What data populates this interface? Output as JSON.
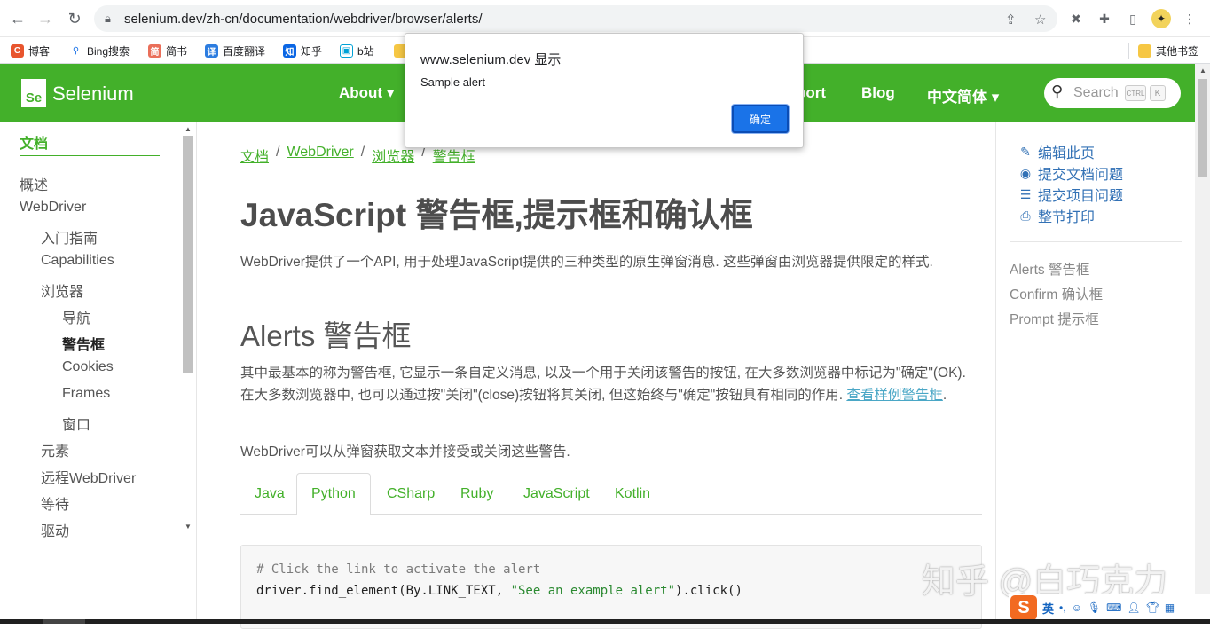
{
  "browser": {
    "url": "selenium.dev/zh-cn/documentation/webdriver/browser/alerts/",
    "bookmarks": [
      "博客",
      "Bing搜索",
      "简书",
      "百度翻译",
      "知乎",
      "b站"
    ],
    "other_bookmarks": "其他书签"
  },
  "site": {
    "brand": "Selenium",
    "nav": [
      "About ▾",
      "port",
      "Blog",
      "中文简体 ▾"
    ],
    "search_placeholder": "Search",
    "kbd_ctrl": "CTRL",
    "kbd_k": "K"
  },
  "sidebar": {
    "heading": "文档",
    "items": [
      "概述",
      "WebDriver",
      "入门指南",
      "Capabilities",
      "浏览器",
      "导航",
      "警告框",
      "Cookies",
      "Frames",
      "窗口",
      "元素",
      "远程WebDriver",
      "等待",
      "驱动"
    ]
  },
  "main": {
    "breadcrumbs": [
      "文档",
      "WebDriver",
      "浏览器",
      "警告框"
    ],
    "title": "JavaScript 警告框,提示框和确认框",
    "intro": "WebDriver提供了一个API, 用于处理JavaScript提供的三种类型的原生弹窗消息. 这些弹窗由浏览器提供限定的样式.",
    "section_title": "Alerts 警告框",
    "para1": "其中最基本的称为警告框, 它显示一条自定义消息, 以及一个用于关闭该警告的按钮, 在大多数浏览器中标记为\"确定\"(OK). 在大多数浏览器中, 也可以通过按\"关闭\"(close)按钮将其关闭, 但这始终与\"确定\"按钮具有相同的作用. ",
    "para1_link": "查看样例警告框",
    "para1_end": ".",
    "para2": "WebDriver可以从弹窗获取文本并接受或关闭这些警告.",
    "tabs": [
      "Java",
      "Python",
      "CSharp",
      "Ruby",
      "JavaScript",
      "Kotlin"
    ],
    "code_line1": "# Click the link to activate the alert",
    "code_line2_a": "driver.find_element(By.LINK_TEXT, ",
    "code_line2_str": "\"See an example alert\"",
    "code_line2_b": ").click()"
  },
  "toc": {
    "actions": [
      "编辑此页",
      "提交文档问题",
      "提交项目问题",
      "整节打印"
    ],
    "items": [
      "Alerts 警告框",
      "Confirm 确认框",
      "Prompt 提示框"
    ]
  },
  "dialog": {
    "title": "www.selenium.dev 显示",
    "message": "Sample alert",
    "ok": "确定"
  },
  "watermark": "知乎 @白巧克力",
  "ime": {
    "lang": "英"
  },
  "colors": {
    "accent": "#43b02a",
    "link": "#3271b5",
    "dialog_button": "#1a73e8"
  }
}
